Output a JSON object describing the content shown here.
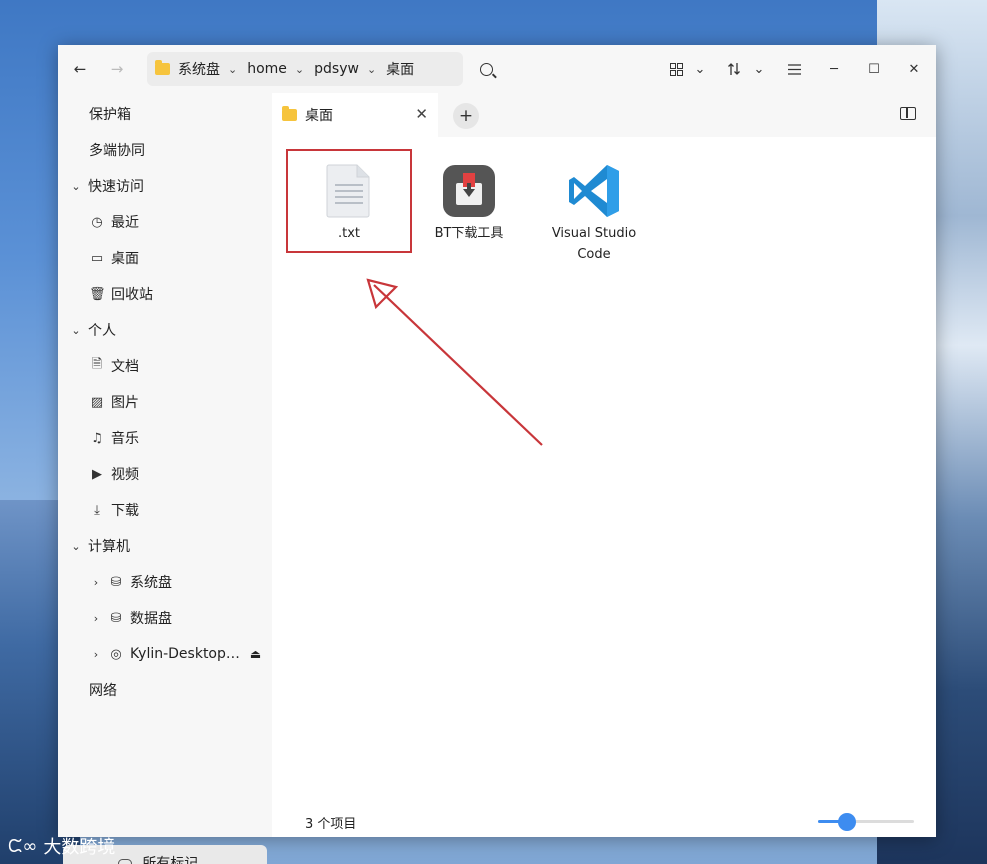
{
  "window": {
    "nav": {
      "back": "←",
      "forward": "→"
    },
    "breadcrumb": [
      "系统盘",
      "home",
      "pdsyw",
      "桌面"
    ],
    "toolbar": {
      "grid_icon": "grid-view-icon",
      "sort_icon": "sort-icon",
      "menu_icon": "menu-icon"
    },
    "window_controls": {
      "minimize": "─",
      "maximize": "☐",
      "close": "✕"
    }
  },
  "sidebar": {
    "items": [
      {
        "label": "保护箱",
        "icon": ""
      },
      {
        "label": "多端协同",
        "icon": ""
      },
      {
        "label": "快速访问",
        "icon": "",
        "section": true
      },
      {
        "label": "最近",
        "icon": "clock-icon"
      },
      {
        "label": "桌面",
        "icon": "desktop-icon"
      },
      {
        "label": "回收站",
        "icon": "trash-icon"
      },
      {
        "label": "个人",
        "icon": "",
        "section": true
      },
      {
        "label": "文档",
        "icon": "document-icon"
      },
      {
        "label": "图片",
        "icon": "image-icon"
      },
      {
        "label": "音乐",
        "icon": "music-icon"
      },
      {
        "label": "视频",
        "icon": "video-icon"
      },
      {
        "label": "下载",
        "icon": "download-icon"
      },
      {
        "label": "计算机",
        "icon": "",
        "section": true
      },
      {
        "label": "系统盘",
        "icon": "disk-icon",
        "expandable": true
      },
      {
        "label": "数据盘",
        "icon": "disk-icon",
        "expandable": true
      },
      {
        "label": "Kylin-Desktop…",
        "icon": "cdrom-icon",
        "expandable": true
      },
      {
        "label": "网络",
        "icon": ""
      }
    ],
    "tag_button": "所有标记..."
  },
  "tabs": [
    {
      "label": "桌面"
    }
  ],
  "files": [
    {
      "name": ".txt",
      "type": "text-file-icon"
    },
    {
      "name": "BT下载工具",
      "type": "bt-download-icon"
    },
    {
      "name": "Visual Studio Code",
      "type": "vscode-icon"
    }
  ],
  "status": {
    "count": "3 个项目",
    "zoom_level": 0.3
  },
  "watermark": "大数跨境",
  "colors": {
    "accent": "#3d8cf0",
    "highlight_box": "#c8363a",
    "folder": "#f6c43d"
  }
}
